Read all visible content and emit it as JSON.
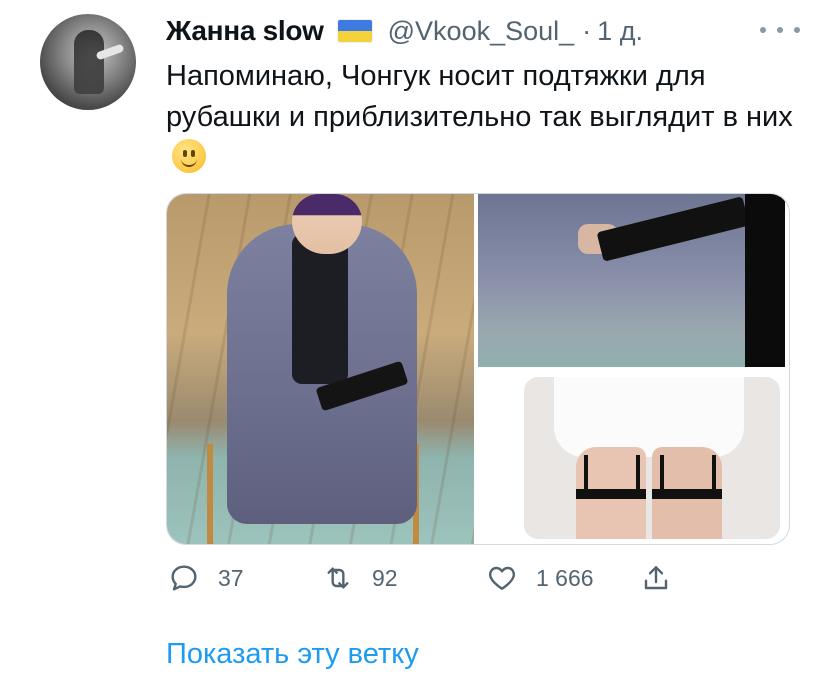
{
  "author": {
    "display_name": "Жанна slow",
    "handle": "@Vkook_Soul_",
    "separator": "·",
    "time": "1 д.",
    "flag_icon": "ukraine-flag-icon"
  },
  "tweet": {
    "text": "Напоминаю, Чонгук носит подтяжки для рубашки и приблизительно так выглядит в них",
    "emoji_icon": "slightly-smiling-face-emoji"
  },
  "media": {
    "count": 3
  },
  "actions": {
    "reply_count": "37",
    "retweet_count": "92",
    "like_count": "1 666"
  },
  "footer": {
    "show_thread_label": "Показать эту ветку"
  },
  "colors": {
    "accent": "#1d9bf0",
    "text": "#0f1419",
    "secondary_text": "#536471"
  }
}
